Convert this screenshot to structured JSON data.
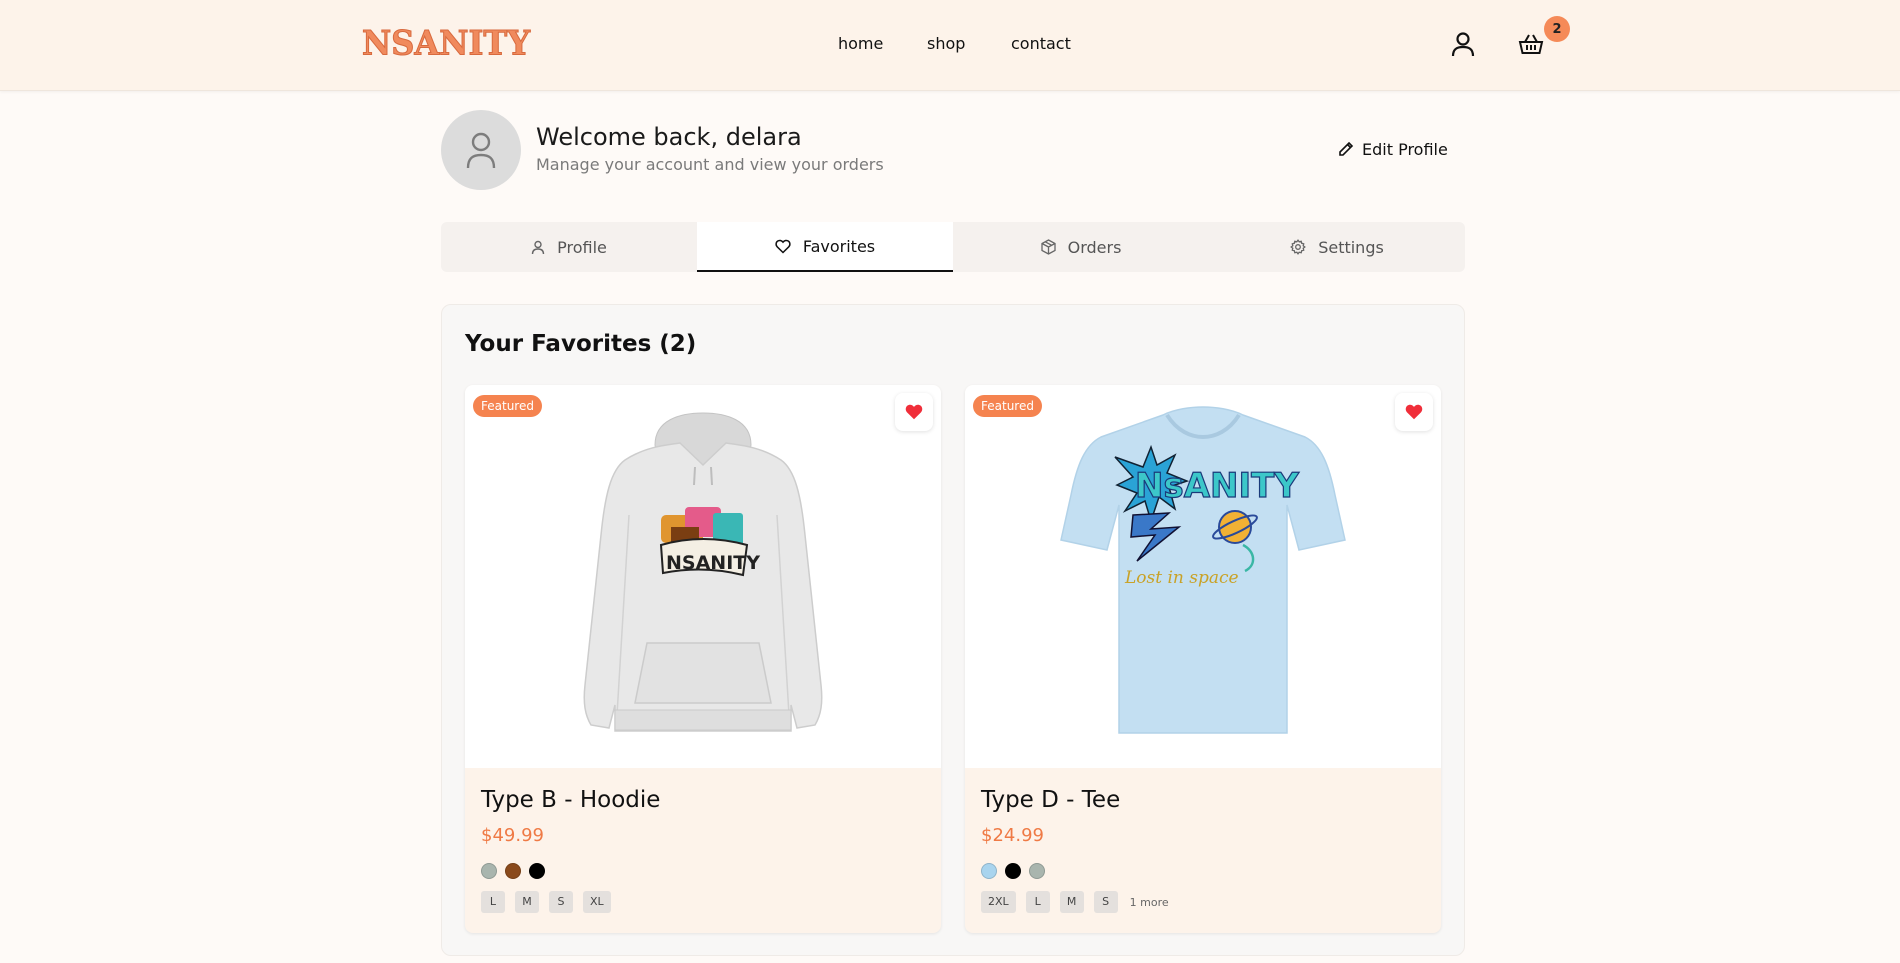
{
  "header": {
    "logo": "NSANITY",
    "nav": [
      {
        "label": "home"
      },
      {
        "label": "shop"
      },
      {
        "label": "contact"
      }
    ],
    "cart_count": "2",
    "icons": {
      "account": "user-icon",
      "cart": "basket-icon"
    }
  },
  "profile": {
    "welcome": "Welcome back, delara",
    "subtitle": "Manage your account and view your orders",
    "edit_label": "Edit Profile"
  },
  "tabs": [
    {
      "label": "Profile",
      "icon": "user-icon",
      "active": false
    },
    {
      "label": "Favorites",
      "icon": "heart-icon",
      "active": true
    },
    {
      "label": "Orders",
      "icon": "package-icon",
      "active": false
    },
    {
      "label": "Settings",
      "icon": "gear-icon",
      "active": false
    }
  ],
  "favorites": {
    "title": "Your Favorites (2)",
    "items": [
      {
        "badge": "Featured",
        "name": "Type B - Hoodie",
        "price": "$49.99",
        "colors": [
          "#a9b5ae",
          "#8a4a1c",
          "#000000"
        ],
        "sizes": [
          "L",
          "M",
          "S",
          "XL"
        ],
        "more": ""
      },
      {
        "badge": "Featured",
        "name": "Type D - Tee",
        "price": "$24.99",
        "colors": [
          "#a9d4ee",
          "#000000",
          "#a9b5ae"
        ],
        "sizes": [
          "2XL",
          "L",
          "M",
          "S"
        ],
        "more": "1 more"
      }
    ]
  },
  "colors": {
    "accent": "#f5834f",
    "price": "#ef7a45",
    "header_bg": "#fdf3ea",
    "heart": "#f02e3a"
  }
}
